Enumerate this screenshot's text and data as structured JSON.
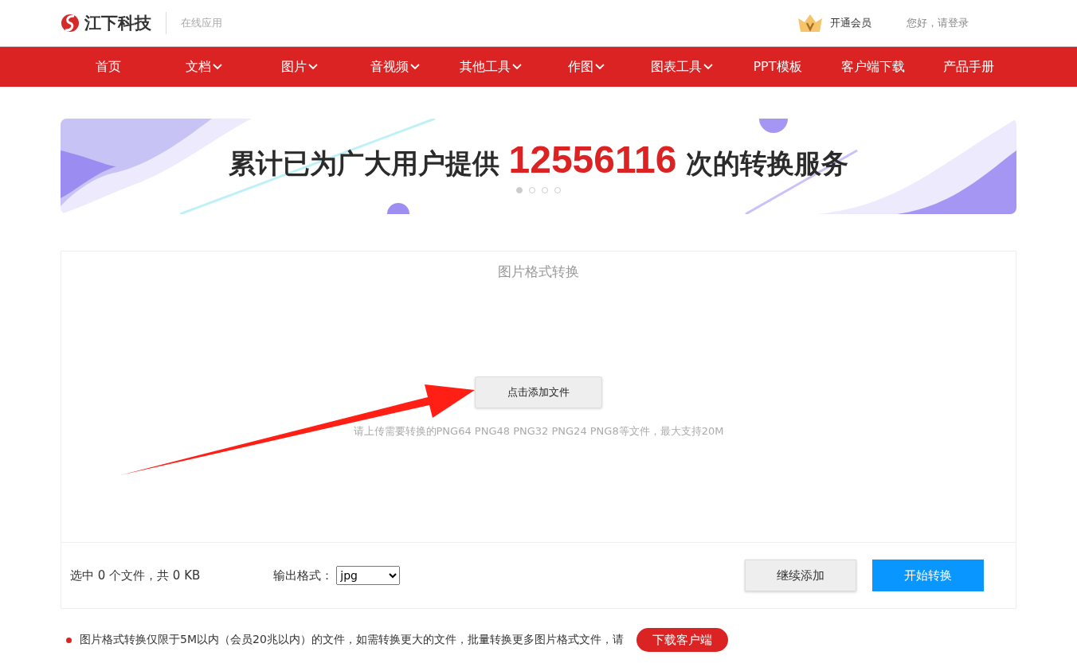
{
  "header": {
    "brand": "江下科技",
    "subtitle": "在线应用",
    "vip_link": "开通会员",
    "login_link": "您好，请登录"
  },
  "nav": [
    {
      "label": "首页",
      "dropdown": false
    },
    {
      "label": "文档",
      "dropdown": true
    },
    {
      "label": "图片",
      "dropdown": true
    },
    {
      "label": "音视频",
      "dropdown": true
    },
    {
      "label": "其他工具",
      "dropdown": true
    },
    {
      "label": "作图",
      "dropdown": true
    },
    {
      "label": "图表工具",
      "dropdown": true
    },
    {
      "label": "PPT模板",
      "dropdown": false
    },
    {
      "label": "客户端下载",
      "dropdown": false
    },
    {
      "label": "产品手册",
      "dropdown": false
    }
  ],
  "banner": {
    "text_before": "累计已为广大用户提供",
    "count": "12556116",
    "text_after": "次的转换服务",
    "dots": [
      {
        "selected": true
      },
      {
        "selected": false
      },
      {
        "selected": false
      },
      {
        "selected": false
      }
    ]
  },
  "converter": {
    "title": "图片格式转换",
    "add_button": "点击添加文件",
    "hint": "请上传需要转换的PNG64 PNG48 PNG32 PNG24 PNG8等文件，最大支持20M",
    "summary": "选中 0 个文件，共 0 KB",
    "output_label": "输出格式：",
    "output_format": "jpg",
    "continue_button": "继续添加",
    "start_button": "开始转换"
  },
  "notice": {
    "text": "图片格式转换仅限于5M以内（会员20兆以内）的文件，如需转换更大的文件，批量转换更多图片格式文件，请",
    "button": "下载客户端"
  }
}
